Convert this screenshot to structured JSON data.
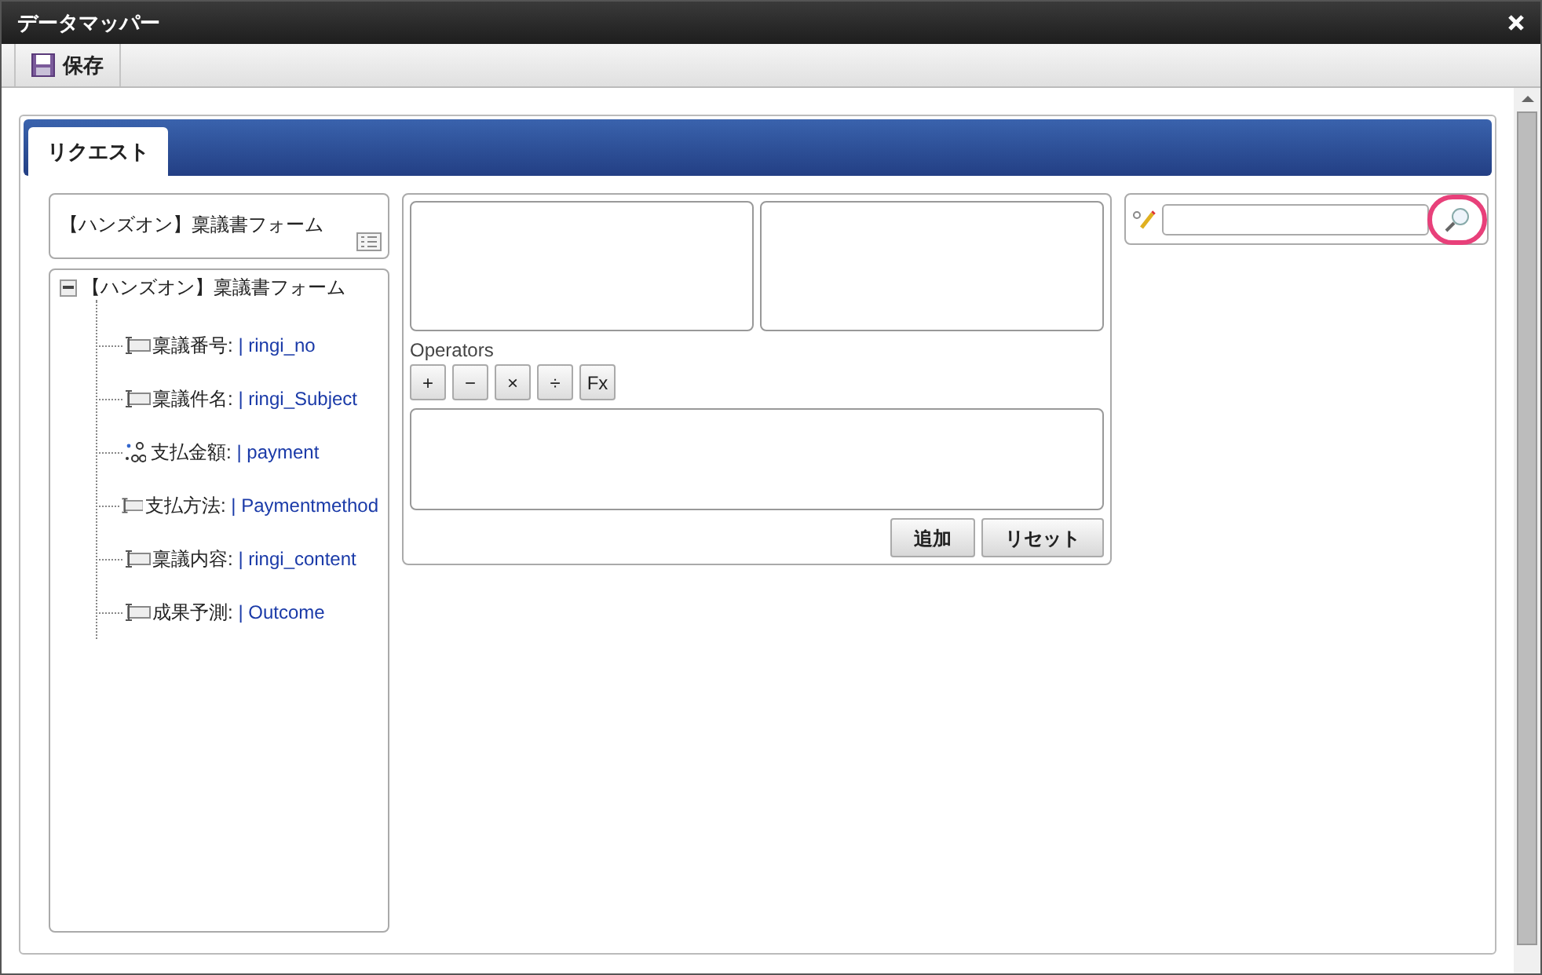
{
  "window": {
    "title": "データマッパー"
  },
  "toolbar": {
    "save_label": "保存"
  },
  "tabs": [
    {
      "label": "リクエスト",
      "selected": true
    }
  ],
  "form_box": {
    "title": "【ハンズオン】稟議書フォーム"
  },
  "tree": {
    "label": "【ハンズオン】稟議書フォーム",
    "expanded": true,
    "children": [
      {
        "kind": "text",
        "label": "稟議番号:",
        "field": "| ringi_no"
      },
      {
        "kind": "text",
        "label": "稟議件名:",
        "field": "| ringi_Subject"
      },
      {
        "kind": "number",
        "label": "支払金額:",
        "field": "| payment"
      },
      {
        "kind": "text",
        "label": "支払方法:",
        "field": "| Paymentmethod"
      },
      {
        "kind": "text",
        "label": "稟議内容:",
        "field": "| ringi_content"
      },
      {
        "kind": "text",
        "label": "成果予測:",
        "field": "| Outcome"
      }
    ]
  },
  "operators_label": "Operators",
  "operators": [
    "+",
    "−",
    "×",
    "÷",
    "Fx"
  ],
  "actions": [
    "追加",
    "リセット"
  ],
  "search": {
    "highlighted": true
  }
}
